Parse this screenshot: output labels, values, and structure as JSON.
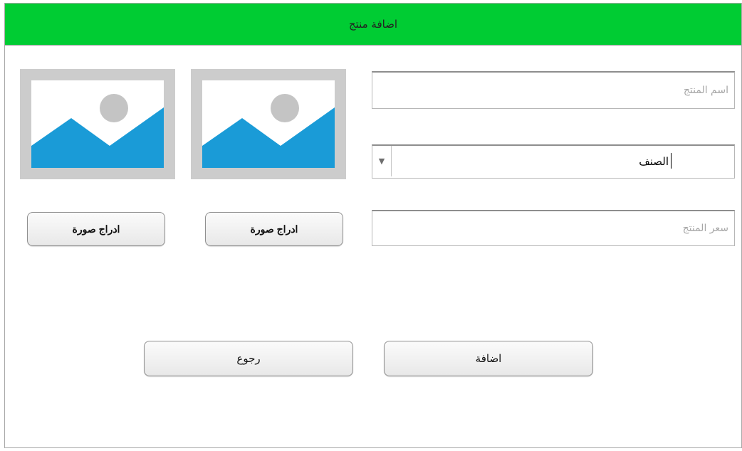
{
  "window": {
    "title": "اضافة منتج"
  },
  "form": {
    "product_name": {
      "placeholder": "اسم المنتج",
      "value": ""
    },
    "category": {
      "selected": "الصنف"
    },
    "product_price": {
      "placeholder": "سعر المنتج",
      "value": ""
    }
  },
  "images": [
    {
      "button_label": "ادراج صورة"
    },
    {
      "button_label": "ادراج صورة"
    }
  ],
  "actions": {
    "add_label": "اضافة",
    "back_label": "رجوع"
  },
  "colors": {
    "titlebar": "#00cc33",
    "image_bg": "#cccccc",
    "image_mountain": "#1a9bd7",
    "image_sun": "#c4c4c4"
  }
}
